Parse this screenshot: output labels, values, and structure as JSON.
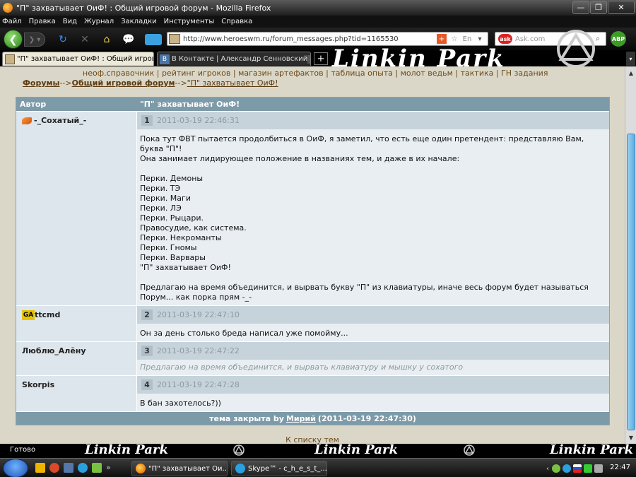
{
  "window": {
    "title": "\"П\" захватывает ОиФ! : Общий игровой форум - Mozilla Firefox",
    "min": "—",
    "max": "❐",
    "close": "✕"
  },
  "menu": [
    "Файл",
    "Правка",
    "Вид",
    "Журнал",
    "Закладки",
    "Инструменты",
    "Справка"
  ],
  "nav": {
    "url": "http://www.heroeswm.ru/forum_messages.php?tid=1165530",
    "search_placeholder": "Ask.com",
    "abp": "ABP"
  },
  "tabs": {
    "active": "\"П\" захватывает ОиФ! : Общий игровой...",
    "inactive": "В Контакте | Александр Сенновский",
    "new_tab": "+"
  },
  "theme": {
    "banner": "Linkin Park"
  },
  "page": {
    "top_links": "неоф.справочник | рейтинг игроков | магазин артефактов | таблица опыта | молот ведьм | тактика | ГН задания",
    "breadcrumb": {
      "forums": "Форумы",
      "sep1": "-->",
      "section": "Общий игровой форум",
      "sep2": "-->",
      "topic": "\"П\" захватывает ОиФ!"
    },
    "table": {
      "col_author": "Автор",
      "col_topic": "\"П\" захватывает ОиФ!"
    },
    "posts": [
      {
        "author": "-_Сохатый_-",
        "num": "1",
        "date": "2011-03-19 22:46:31",
        "lines": [
          "Пока тут ФВТ пытается продолбиться в ОиФ, я заметил, что есть еще один претендент: представляю Вам, буква \"П\"!",
          "Она занимает лидирующее положение в названиях тем, и даже в их начале:",
          "",
          "Перки. Демоны",
          "Перки. ТЭ",
          "Перки. Маги",
          "Перки. ЛЭ",
          "Перки. Рыцари.",
          "Правосудие, как система.",
          "Перки. Некроманты",
          "Перки. Гномы",
          "Перки. Варвары",
          "\"П\" захватывает ОиФ!",
          "",
          "Предлагаю на время объединится, и вырвать букву \"П\" из клавиатуры, иначе весь форум будет называться Порум... как порка прям -_-"
        ]
      },
      {
        "author": "ttcmd",
        "avatar_text": "GA",
        "num": "2",
        "date": "2011-03-19 22:47:10",
        "lines": [
          "Он за день столько бреда написал уже помойму..."
        ]
      },
      {
        "author": "Люблю_Алёну",
        "num": "3",
        "date": "2011-03-19 22:47:22",
        "lines": [
          "Предлагаю на время объединится, и вырвать клавиатуру и мышку у сохатого"
        ]
      },
      {
        "author": "Skorpis",
        "num": "4",
        "date": "2011-03-19 22:47:28",
        "lines": [
          "В бан захотелось?))"
        ]
      }
    ],
    "footer": {
      "prefix": "тема закрыта by",
      "user": "Мирий",
      "time": "(2011-03-19 22:47:30)"
    },
    "back_to_list": "К списку тем"
  },
  "status": {
    "text": "Готово"
  },
  "taskbar": {
    "items": [
      "\"П\" захватывает Ои...",
      "Skype™ - c_h_e_s_t_..."
    ],
    "clock": "22:47"
  }
}
